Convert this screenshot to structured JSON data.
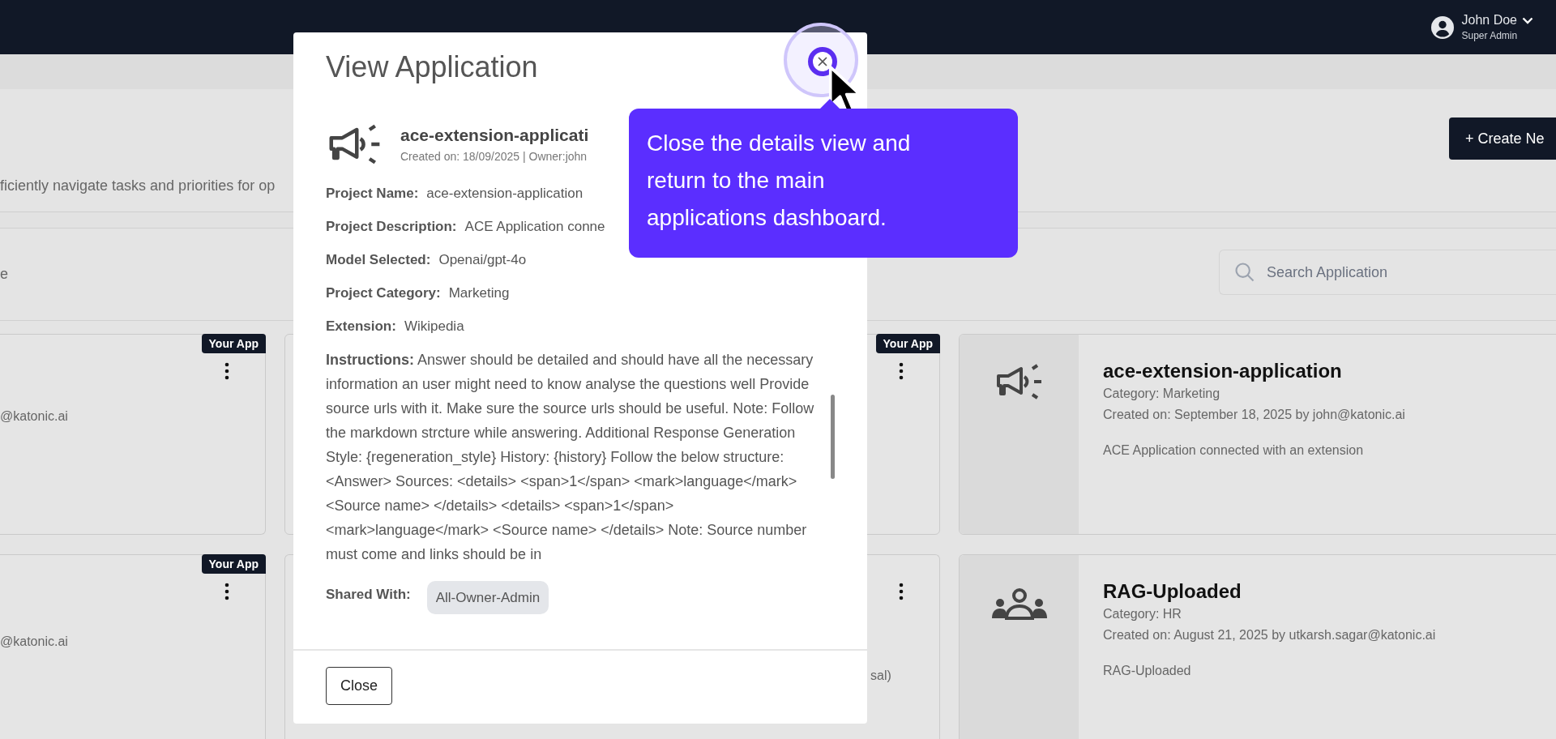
{
  "top_bar": {
    "user": {
      "name": "John Doe",
      "role": "Super Admin"
    }
  },
  "header": {
    "subtitle": "ficiently navigate tasks and priorities for op",
    "create_button": "+ Create Ne"
  },
  "filter_bar": {
    "label": "e",
    "search": {
      "placeholder": "Search Application"
    }
  },
  "card_rows": [
    {
      "cards": [
        {
          "kind": "partial",
          "badge": "Your App",
          "text": "@katonic.ai"
        },
        {
          "kind": "hidden",
          "badge": "Your App"
        },
        {
          "kind": "full",
          "title": "ace-extension-application",
          "category": "Category: Marketing",
          "created": "Created on: September 18, 2025 by john@katonic.ai",
          "description": "ACE Application connected with an extension"
        }
      ]
    },
    {
      "cards": [
        {
          "kind": "partial",
          "badge": "Your App",
          "text": "@katonic.ai"
        },
        {
          "kind": "hidden",
          "text": "sal)"
        },
        {
          "kind": "full",
          "title": "RAG-Uploaded",
          "category": "Category: HR",
          "created": "Created on: August 21, 2025 by utkarsh.sagar@katonic.ai",
          "description": "RAG-Uploaded"
        }
      ]
    }
  ],
  "modal": {
    "title": "View Application",
    "app": {
      "name": "ace-extension-applicati",
      "meta": "Created on: 18/09/2025 | Owner:john"
    },
    "fields": [
      {
        "kind": "text",
        "label": "Project Name:",
        "value": "ace-extension-application"
      },
      {
        "kind": "text",
        "label": "Project Description:",
        "value": "ACE Application conne"
      },
      {
        "kind": "text",
        "label": "Model Selected:",
        "value": "Openai/gpt-4o"
      },
      {
        "kind": "text",
        "label": "Project Category:",
        "value": "Marketing"
      },
      {
        "kind": "text",
        "label": "Extension:",
        "value": "Wikipedia"
      },
      {
        "kind": "paragraph",
        "label": "Instructions:",
        "value": "Answer should be detailed and should have all the necessary information an user might need to know analyse the questions well Provide source urls with it. Make sure the source urls should be useful. Note: Follow the markdown strcture while answering. Additional Response Generation Style: {regeneration_style} History: {history} Follow the below structure: <Answer> Sources: <details> <span>1</span> <mark>language</mark> <Source name> </details> <details> <span>1</span> <mark>language</mark> <Source name> </details> Note: Source number must come and links should be in"
      },
      {
        "kind": "chip",
        "label": "Shared With:",
        "value": "All-Owner-Admin"
      }
    ],
    "close_button": "Close"
  },
  "tooltip": {
    "text": "Close the details view and return to the main applications dashboard."
  }
}
